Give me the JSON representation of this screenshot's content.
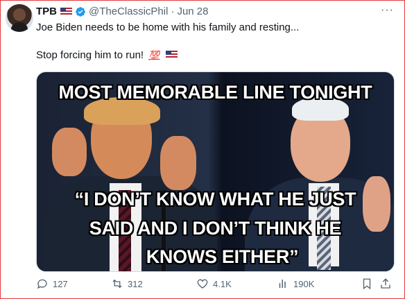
{
  "tweet": {
    "display_name": "TPB",
    "handle": "@TheClassicPhil",
    "separator": "·",
    "date": "Jun 28",
    "text_line1": "Joe Biden needs to be home with his family and resting...",
    "text_line2": "Stop forcing him to run!",
    "emoji_100": "💯",
    "more_label": "···"
  },
  "media": {
    "caption_top": "MOST MEMORABLE LINE TONIGHT",
    "quote_line1": "“I DON’T KNOW WHAT HE JUST",
    "quote_line2": "SAID AND I DON’T THINK HE",
    "quote_line3": "KNOWS EITHER”"
  },
  "actions": {
    "replies": "127",
    "reposts": "312",
    "likes": "4.1K",
    "views": "190K"
  },
  "colors": {
    "accent": "#1d9bf0",
    "muted_text": "#536471",
    "frame_border": "#e23a3a"
  }
}
